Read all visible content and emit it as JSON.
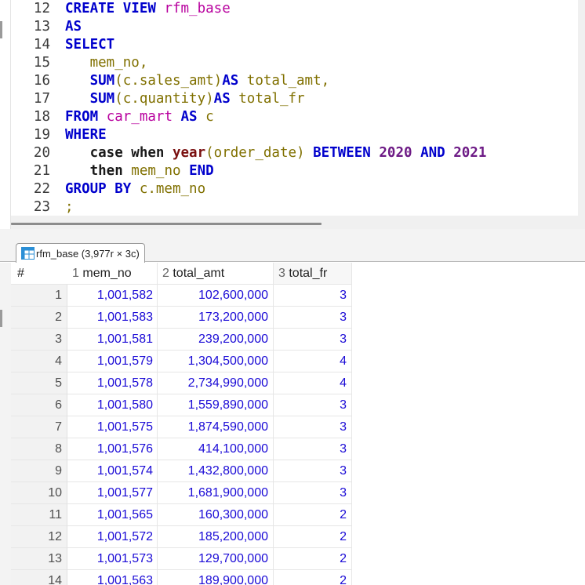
{
  "editor": {
    "lines": [
      {
        "num": "12",
        "tokens": [
          {
            "t": "CREATE VIEW ",
            "c": "kw"
          },
          {
            "t": "rfm_base",
            "c": "id"
          }
        ]
      },
      {
        "num": "13",
        "tokens": [
          {
            "t": "AS",
            "c": "kw"
          }
        ]
      },
      {
        "num": "14",
        "tokens": [
          {
            "t": "SELECT",
            "c": "kw"
          }
        ]
      },
      {
        "num": "15",
        "tokens": [
          {
            "t": "   ",
            "c": "pl"
          },
          {
            "t": "mem_no",
            "c": "col"
          },
          {
            "t": ",",
            "c": "col"
          }
        ]
      },
      {
        "num": "16",
        "tokens": [
          {
            "t": "   ",
            "c": "pl"
          },
          {
            "t": "SUM",
            "c": "kw"
          },
          {
            "t": "(c.sales_amt)",
            "c": "col"
          },
          {
            "t": "AS ",
            "c": "kw"
          },
          {
            "t": "total_amt,",
            "c": "col"
          }
        ]
      },
      {
        "num": "17",
        "tokens": [
          {
            "t": "   ",
            "c": "pl"
          },
          {
            "t": "SUM",
            "c": "kw"
          },
          {
            "t": "(c.quantity)",
            "c": "col"
          },
          {
            "t": "AS ",
            "c": "kw"
          },
          {
            "t": "total_fr",
            "c": "col"
          }
        ]
      },
      {
        "num": "18",
        "tokens": [
          {
            "t": "FROM ",
            "c": "kw"
          },
          {
            "t": "car_mart",
            "c": "id"
          },
          {
            "t": " AS ",
            "c": "kw"
          },
          {
            "t": "c",
            "c": "col"
          }
        ]
      },
      {
        "num": "19",
        "tokens": [
          {
            "t": "WHERE",
            "c": "kw"
          }
        ]
      },
      {
        "num": "20",
        "tokens": [
          {
            "t": "   ",
            "c": "pl"
          },
          {
            "t": "case when ",
            "c": "pl",
            "b": true
          },
          {
            "t": "year",
            "c": "fn"
          },
          {
            "t": "(order_date) ",
            "c": "col"
          },
          {
            "t": "BETWEEN ",
            "c": "kw"
          },
          {
            "t": "2020",
            "c": "num"
          },
          {
            "t": " AND ",
            "c": "kw"
          },
          {
            "t": "2021",
            "c": "num"
          }
        ]
      },
      {
        "num": "21",
        "tokens": [
          {
            "t": "   ",
            "c": "pl"
          },
          {
            "t": "then ",
            "c": "pl",
            "b": true
          },
          {
            "t": "mem_no ",
            "c": "col"
          },
          {
            "t": "END",
            "c": "kw"
          }
        ]
      },
      {
        "num": "22",
        "tokens": [
          {
            "t": "GROUP BY ",
            "c": "kw"
          },
          {
            "t": "c.mem_no",
            "c": "col"
          }
        ]
      },
      {
        "num": "23",
        "tokens": [
          {
            "t": ";",
            "c": "col"
          }
        ]
      }
    ]
  },
  "results": {
    "tab_label": "rfm_base (3,977r × 3c)",
    "tab_icon": "table-grid-icon",
    "columns": {
      "idx": "#",
      "c1_num": "1",
      "c1_name": "mem_no",
      "c2_num": "2",
      "c2_name": "total_amt",
      "c3_num": "3",
      "c3_name": "total_fr"
    },
    "rows": [
      [
        "1",
        "1,001,582",
        "102,600,000",
        "3"
      ],
      [
        "2",
        "1,001,583",
        "173,200,000",
        "3"
      ],
      [
        "3",
        "1,001,581",
        "239,200,000",
        "3"
      ],
      [
        "4",
        "1,001,579",
        "1,304,500,000",
        "4"
      ],
      [
        "5",
        "1,001,578",
        "2,734,990,000",
        "4"
      ],
      [
        "6",
        "1,001,580",
        "1,559,890,000",
        "3"
      ],
      [
        "7",
        "1,001,575",
        "1,874,590,000",
        "3"
      ],
      [
        "8",
        "1,001,576",
        "414,100,000",
        "3"
      ],
      [
        "9",
        "1,001,574",
        "1,432,800,000",
        "3"
      ],
      [
        "10",
        "1,001,577",
        "1,681,900,000",
        "3"
      ],
      [
        "11",
        "1,001,565",
        "160,300,000",
        "2"
      ],
      [
        "12",
        "1,001,572",
        "185,200,000",
        "2"
      ],
      [
        "13",
        "1,001,573",
        "129,700,000",
        "2"
      ],
      [
        "14",
        "1,001,563",
        "189,900,000",
        "2"
      ]
    ]
  },
  "colors": {
    "keyword": "#0000cc",
    "identifier": "#b8009e",
    "column": "#807000",
    "function": "#7a1010",
    "number": "#6d1a85",
    "cell_value": "#1a0ad6"
  }
}
